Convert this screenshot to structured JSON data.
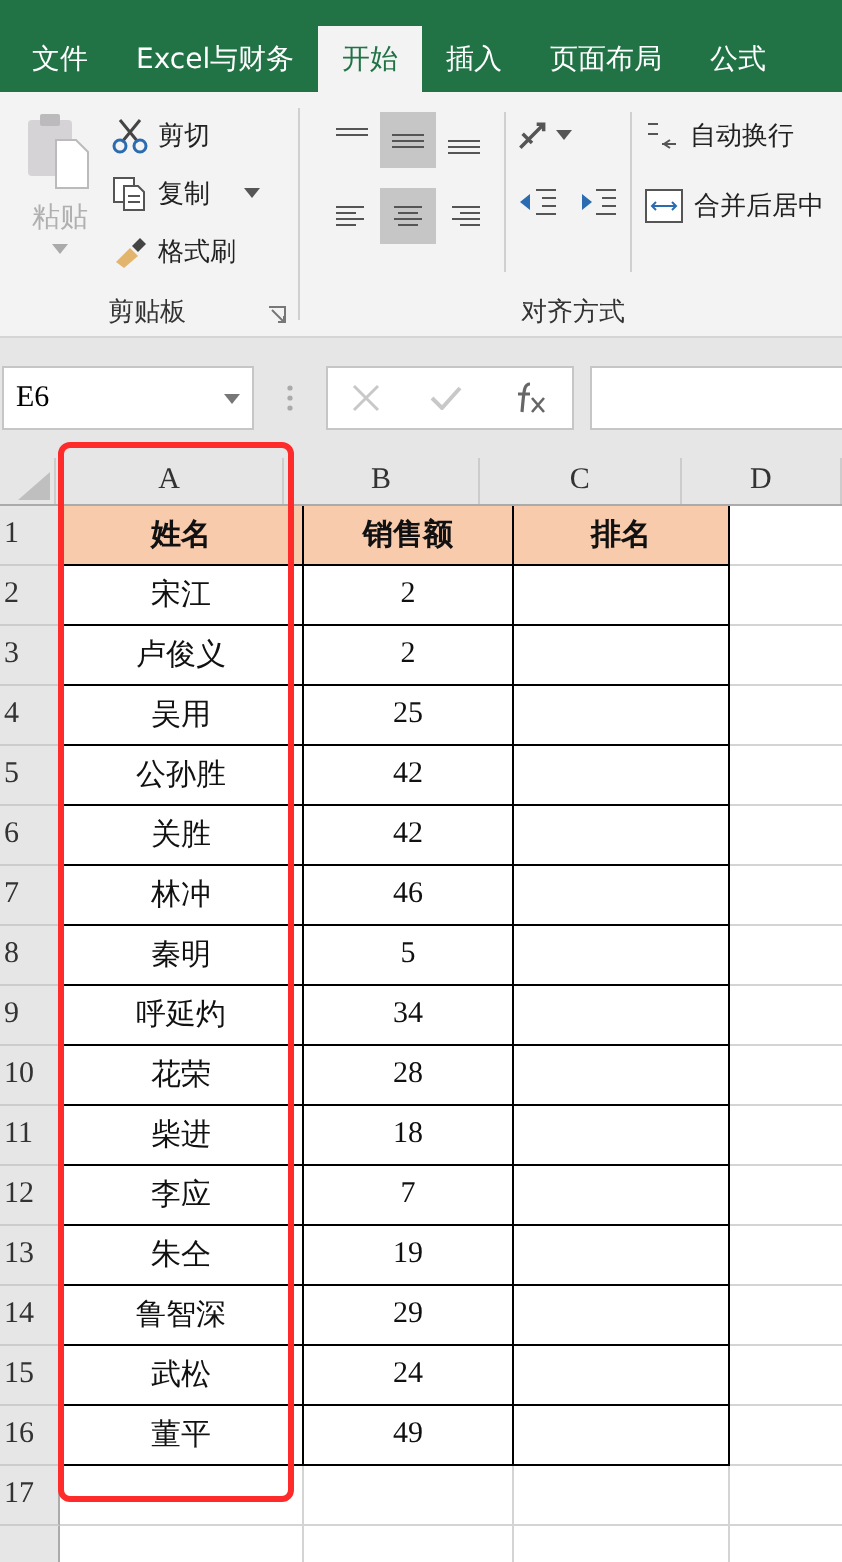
{
  "tabs": [
    {
      "label": "文件",
      "selected": false
    },
    {
      "label": "Excel与财务",
      "selected": false
    },
    {
      "label": "开始",
      "selected": true
    },
    {
      "label": "插入",
      "selected": false
    },
    {
      "label": "页面布局",
      "selected": false
    },
    {
      "label": "公式",
      "selected": false
    }
  ],
  "clipboard": {
    "paste": {
      "label": "粘贴",
      "disabled": true
    },
    "items": [
      {
        "kind": "cut",
        "label": "剪切"
      },
      {
        "kind": "copy",
        "label": "复制",
        "dropdown": true
      },
      {
        "kind": "painter",
        "label": "格式刷"
      }
    ],
    "group_label": "剪贴板"
  },
  "alignment": {
    "buttons": [
      {
        "kind": "top",
        "selected": false
      },
      {
        "kind": "middle",
        "selected": true
      },
      {
        "kind": "bottom",
        "selected": false
      },
      {
        "kind": "left",
        "selected": false
      },
      {
        "kind": "center",
        "selected": true
      },
      {
        "kind": "right",
        "selected": false
      }
    ],
    "actions": [
      {
        "kind": "wrap",
        "label": "自动换行"
      },
      {
        "kind": "merge",
        "label": "合并后居中"
      }
    ],
    "group_label": "对齐方式"
  },
  "name_box": {
    "value": "E6"
  },
  "columns": [
    "A",
    "B",
    "C",
    "D"
  ],
  "rows": [
    {
      "number": "1",
      "cells": [
        "姓名",
        "销售额",
        "排名"
      ],
      "header": true
    },
    {
      "number": "2",
      "cells": [
        "宋江",
        "2",
        ""
      ],
      "header": false
    },
    {
      "number": "3",
      "cells": [
        "卢俊义",
        "2",
        ""
      ],
      "header": false
    },
    {
      "number": "4",
      "cells": [
        "吴用",
        "25",
        ""
      ],
      "header": false
    },
    {
      "number": "5",
      "cells": [
        "公孙胜",
        "42",
        ""
      ],
      "header": false
    },
    {
      "number": "6",
      "cells": [
        "关胜",
        "42",
        ""
      ],
      "header": false
    },
    {
      "number": "7",
      "cells": [
        "林冲",
        "46",
        ""
      ],
      "header": false
    },
    {
      "number": "8",
      "cells": [
        "秦明",
        "5",
        ""
      ],
      "header": false
    },
    {
      "number": "9",
      "cells": [
        "呼延灼",
        "34",
        ""
      ],
      "header": false
    },
    {
      "number": "10",
      "cells": [
        "花荣",
        "28",
        ""
      ],
      "header": false
    },
    {
      "number": "11",
      "cells": [
        "柴进",
        "18",
        ""
      ],
      "header": false
    },
    {
      "number": "12",
      "cells": [
        "李应",
        "7",
        ""
      ],
      "header": false
    },
    {
      "number": "13",
      "cells": [
        "朱仝",
        "19",
        ""
      ],
      "header": false
    },
    {
      "number": "14",
      "cells": [
        "鲁智深",
        "29",
        ""
      ],
      "header": false
    },
    {
      "number": "15",
      "cells": [
        "武松",
        "24",
        ""
      ],
      "header": false
    },
    {
      "number": "16",
      "cells": [
        "董平",
        "49",
        ""
      ],
      "header": false
    },
    {
      "number": "17",
      "cells": [
        "",
        "",
        ""
      ],
      "header": false
    }
  ]
}
